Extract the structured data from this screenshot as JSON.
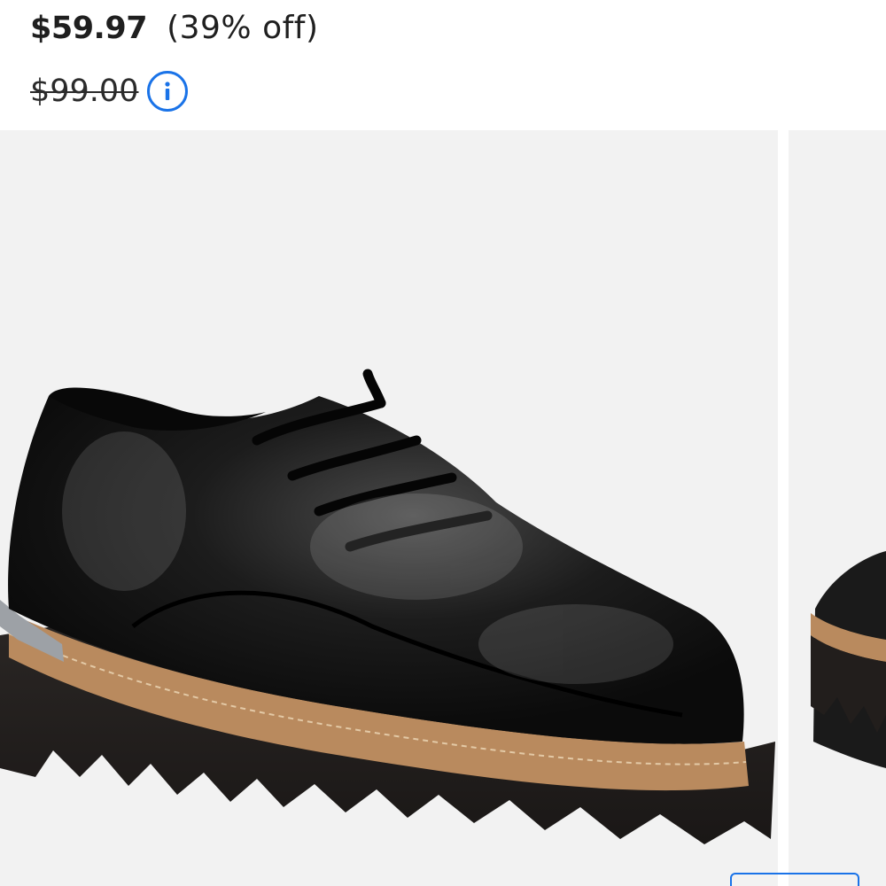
{
  "pricing": {
    "sale_price": "$59.97",
    "discount": "(39% off)",
    "original_price": "$99.00",
    "info_icon": "info-icon"
  },
  "gallery": {
    "main_image": "black patent leather lace-up oxford shoe on lug sole",
    "next_image": "partial view of next shoe image"
  },
  "colors": {
    "accent": "#1a73e8",
    "text": "#1f1f1f",
    "image_bg": "#f2f2f2"
  }
}
